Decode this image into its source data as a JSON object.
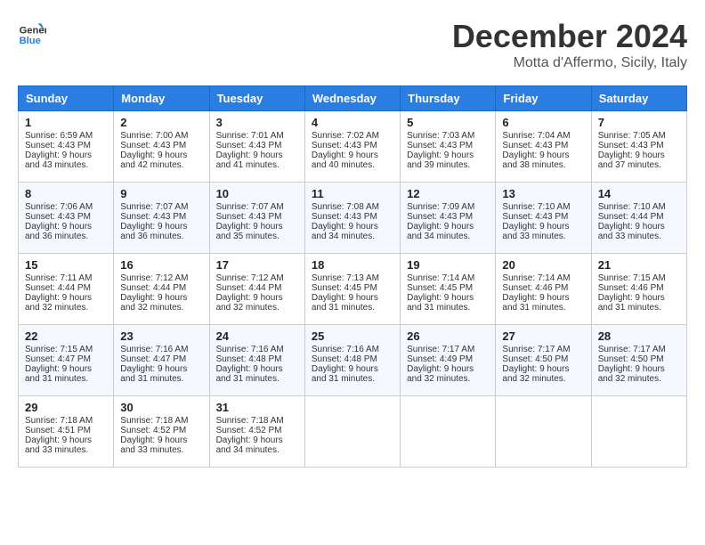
{
  "logo": {
    "line1": "General",
    "line2": "Blue"
  },
  "header": {
    "month": "December 2024",
    "location": "Motta d'Affermo, Sicily, Italy"
  },
  "weekdays": [
    "Sunday",
    "Monday",
    "Tuesday",
    "Wednesday",
    "Thursday",
    "Friday",
    "Saturday"
  ],
  "weeks": [
    [
      {
        "day": "1",
        "sunrise": "Sunrise: 6:59 AM",
        "sunset": "Sunset: 4:43 PM",
        "daylight": "Daylight: 9 hours and 43 minutes."
      },
      {
        "day": "2",
        "sunrise": "Sunrise: 7:00 AM",
        "sunset": "Sunset: 4:43 PM",
        "daylight": "Daylight: 9 hours and 42 minutes."
      },
      {
        "day": "3",
        "sunrise": "Sunrise: 7:01 AM",
        "sunset": "Sunset: 4:43 PM",
        "daylight": "Daylight: 9 hours and 41 minutes."
      },
      {
        "day": "4",
        "sunrise": "Sunrise: 7:02 AM",
        "sunset": "Sunset: 4:43 PM",
        "daylight": "Daylight: 9 hours and 40 minutes."
      },
      {
        "day": "5",
        "sunrise": "Sunrise: 7:03 AM",
        "sunset": "Sunset: 4:43 PM",
        "daylight": "Daylight: 9 hours and 39 minutes."
      },
      {
        "day": "6",
        "sunrise": "Sunrise: 7:04 AM",
        "sunset": "Sunset: 4:43 PM",
        "daylight": "Daylight: 9 hours and 38 minutes."
      },
      {
        "day": "7",
        "sunrise": "Sunrise: 7:05 AM",
        "sunset": "Sunset: 4:43 PM",
        "daylight": "Daylight: 9 hours and 37 minutes."
      }
    ],
    [
      {
        "day": "8",
        "sunrise": "Sunrise: 7:06 AM",
        "sunset": "Sunset: 4:43 PM",
        "daylight": "Daylight: 9 hours and 36 minutes."
      },
      {
        "day": "9",
        "sunrise": "Sunrise: 7:07 AM",
        "sunset": "Sunset: 4:43 PM",
        "daylight": "Daylight: 9 hours and 36 minutes."
      },
      {
        "day": "10",
        "sunrise": "Sunrise: 7:07 AM",
        "sunset": "Sunset: 4:43 PM",
        "daylight": "Daylight: 9 hours and 35 minutes."
      },
      {
        "day": "11",
        "sunrise": "Sunrise: 7:08 AM",
        "sunset": "Sunset: 4:43 PM",
        "daylight": "Daylight: 9 hours and 34 minutes."
      },
      {
        "day": "12",
        "sunrise": "Sunrise: 7:09 AM",
        "sunset": "Sunset: 4:43 PM",
        "daylight": "Daylight: 9 hours and 34 minutes."
      },
      {
        "day": "13",
        "sunrise": "Sunrise: 7:10 AM",
        "sunset": "Sunset: 4:43 PM",
        "daylight": "Daylight: 9 hours and 33 minutes."
      },
      {
        "day": "14",
        "sunrise": "Sunrise: 7:10 AM",
        "sunset": "Sunset: 4:44 PM",
        "daylight": "Daylight: 9 hours and 33 minutes."
      }
    ],
    [
      {
        "day": "15",
        "sunrise": "Sunrise: 7:11 AM",
        "sunset": "Sunset: 4:44 PM",
        "daylight": "Daylight: 9 hours and 32 minutes."
      },
      {
        "day": "16",
        "sunrise": "Sunrise: 7:12 AM",
        "sunset": "Sunset: 4:44 PM",
        "daylight": "Daylight: 9 hours and 32 minutes."
      },
      {
        "day": "17",
        "sunrise": "Sunrise: 7:12 AM",
        "sunset": "Sunset: 4:44 PM",
        "daylight": "Daylight: 9 hours and 32 minutes."
      },
      {
        "day": "18",
        "sunrise": "Sunrise: 7:13 AM",
        "sunset": "Sunset: 4:45 PM",
        "daylight": "Daylight: 9 hours and 31 minutes."
      },
      {
        "day": "19",
        "sunrise": "Sunrise: 7:14 AM",
        "sunset": "Sunset: 4:45 PM",
        "daylight": "Daylight: 9 hours and 31 minutes."
      },
      {
        "day": "20",
        "sunrise": "Sunrise: 7:14 AM",
        "sunset": "Sunset: 4:46 PM",
        "daylight": "Daylight: 9 hours and 31 minutes."
      },
      {
        "day": "21",
        "sunrise": "Sunrise: 7:15 AM",
        "sunset": "Sunset: 4:46 PM",
        "daylight": "Daylight: 9 hours and 31 minutes."
      }
    ],
    [
      {
        "day": "22",
        "sunrise": "Sunrise: 7:15 AM",
        "sunset": "Sunset: 4:47 PM",
        "daylight": "Daylight: 9 hours and 31 minutes."
      },
      {
        "day": "23",
        "sunrise": "Sunrise: 7:16 AM",
        "sunset": "Sunset: 4:47 PM",
        "daylight": "Daylight: 9 hours and 31 minutes."
      },
      {
        "day": "24",
        "sunrise": "Sunrise: 7:16 AM",
        "sunset": "Sunset: 4:48 PM",
        "daylight": "Daylight: 9 hours and 31 minutes."
      },
      {
        "day": "25",
        "sunrise": "Sunrise: 7:16 AM",
        "sunset": "Sunset: 4:48 PM",
        "daylight": "Daylight: 9 hours and 31 minutes."
      },
      {
        "day": "26",
        "sunrise": "Sunrise: 7:17 AM",
        "sunset": "Sunset: 4:49 PM",
        "daylight": "Daylight: 9 hours and 32 minutes."
      },
      {
        "day": "27",
        "sunrise": "Sunrise: 7:17 AM",
        "sunset": "Sunset: 4:50 PM",
        "daylight": "Daylight: 9 hours and 32 minutes."
      },
      {
        "day": "28",
        "sunrise": "Sunrise: 7:17 AM",
        "sunset": "Sunset: 4:50 PM",
        "daylight": "Daylight: 9 hours and 32 minutes."
      }
    ],
    [
      {
        "day": "29",
        "sunrise": "Sunrise: 7:18 AM",
        "sunset": "Sunset: 4:51 PM",
        "daylight": "Daylight: 9 hours and 33 minutes."
      },
      {
        "day": "30",
        "sunrise": "Sunrise: 7:18 AM",
        "sunset": "Sunset: 4:52 PM",
        "daylight": "Daylight: 9 hours and 33 minutes."
      },
      {
        "day": "31",
        "sunrise": "Sunrise: 7:18 AM",
        "sunset": "Sunset: 4:52 PM",
        "daylight": "Daylight: 9 hours and 34 minutes."
      },
      null,
      null,
      null,
      null
    ]
  ]
}
